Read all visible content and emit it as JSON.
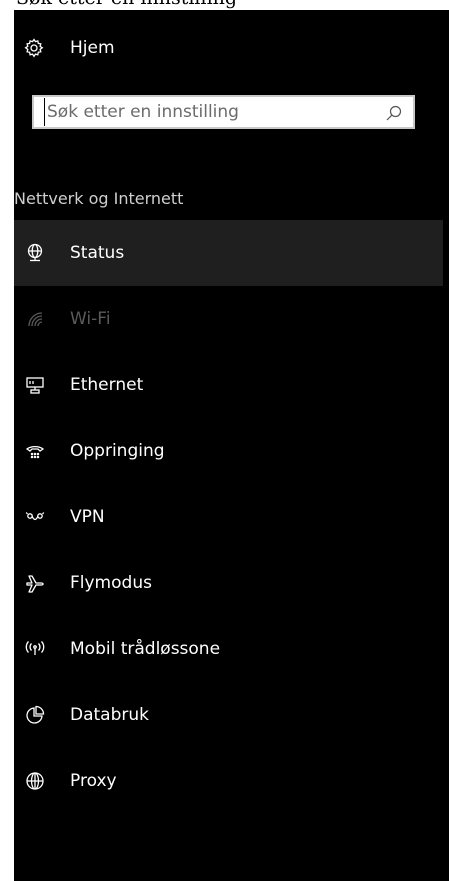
{
  "top_cropped_text": "Søk etter en innstilling",
  "home": {
    "label": "Hjem",
    "icon": "gear-icon"
  },
  "search": {
    "placeholder": "Søk etter en innstilling",
    "icon": "search-icon"
  },
  "section": {
    "title": "Nettverk og Internett"
  },
  "nav": {
    "items": [
      {
        "label": "Status",
        "icon": "globe-network-status-icon",
        "selected": true
      },
      {
        "label": "Wi-Fi",
        "icon": "wifi-icon",
        "disabled": true
      },
      {
        "label": "Ethernet",
        "icon": "ethernet-icon"
      },
      {
        "label": "Oppringing",
        "icon": "dialup-icon"
      },
      {
        "label": "VPN",
        "icon": "vpn-icon"
      },
      {
        "label": "Flymodus",
        "icon": "airplane-icon"
      },
      {
        "label": "Mobil trådløssone",
        "icon": "hotspot-icon"
      },
      {
        "label": "Databruk",
        "icon": "data-usage-icon"
      },
      {
        "label": "Proxy",
        "icon": "globe-icon"
      }
    ]
  },
  "colors": {
    "background": "#000000",
    "selected_row": "#1f1f1f",
    "disabled_text": "#5a5a5a",
    "section_text": "#cfcfcf"
  }
}
